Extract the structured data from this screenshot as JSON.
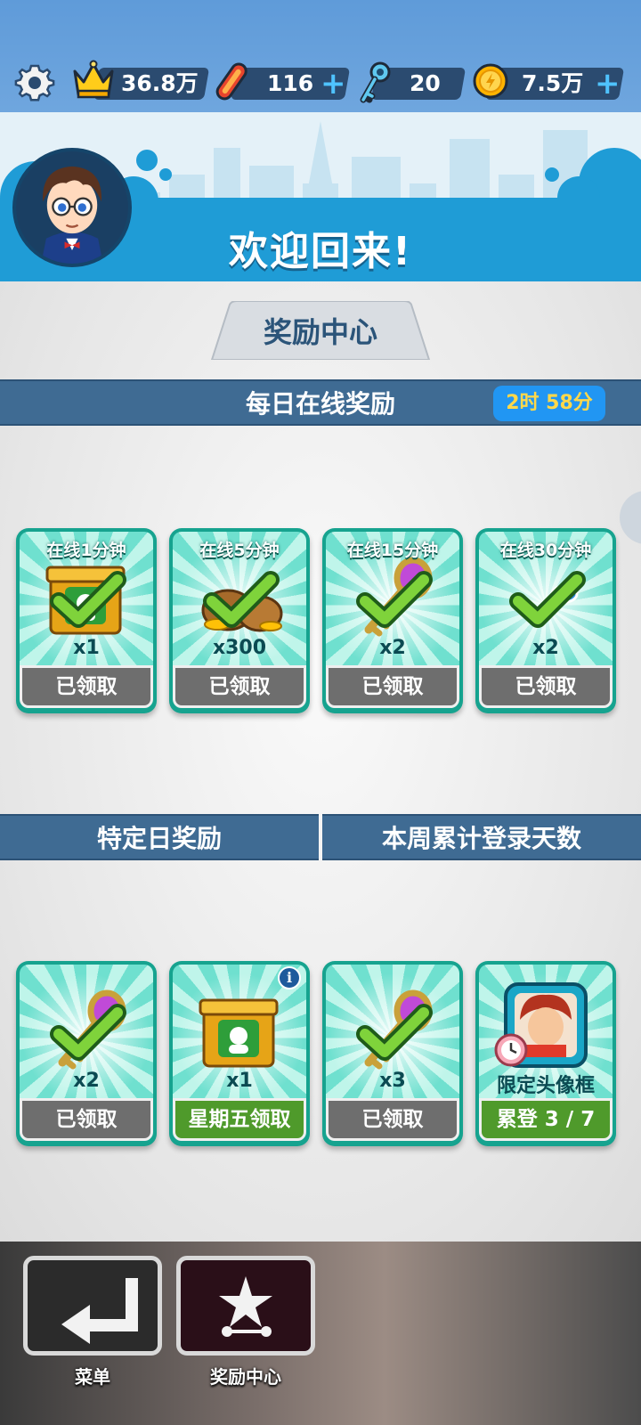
{
  "resources": {
    "crown": {
      "value": "36.8万",
      "icon": "crown-icon"
    },
    "hoverboard": {
      "value": "116",
      "icon": "hoverboard-icon"
    },
    "keys": {
      "value": "20",
      "icon": "key-icon"
    },
    "coins": {
      "value": "7.5万",
      "icon": "coin-icon"
    },
    "plus": "+"
  },
  "header": {
    "welcome": "欢迎回来!"
  },
  "tab": {
    "label": "奖励中心"
  },
  "daily": {
    "title": "每日在线奖励",
    "timer": "2时 58分",
    "cards": [
      {
        "title": "在线1分钟",
        "qty": "x1",
        "button": "已领取",
        "item": "mystery-box-icon"
      },
      {
        "title": "在线5分钟",
        "qty": "x300",
        "button": "已领取",
        "item": "coin-bags-icon"
      },
      {
        "title": "在线15分钟",
        "qty": "x2",
        "button": "已领取",
        "item": "key-icon"
      },
      {
        "title": "在线30分钟",
        "qty": "x2",
        "button": "已领取",
        "item": "hoverboard-icon"
      }
    ]
  },
  "special": {
    "left_title": "特定日奖励",
    "right_title": "本周累计登录天数",
    "cards": [
      {
        "qty": "x2",
        "button": "已领取",
        "item": "key-icon"
      },
      {
        "qty": "x1",
        "button": "星期五领取",
        "item": "mystery-box-icon"
      },
      {
        "qty": "x3",
        "button": "已领取",
        "item": "key-icon"
      },
      {
        "qty": "限定头像框",
        "button": "累登 3 / 7",
        "item": "avatar-frame-icon"
      }
    ]
  },
  "bottom": {
    "menu_label": "菜单",
    "rewards_label": "奖励中心"
  },
  "colors": {
    "top_bar": "#6fa6de",
    "section_bar": "#3f6b93",
    "card_teal": "#16a38f",
    "claimed_gray": "#6e6e6e",
    "claim_green": "#4f9a2b",
    "timer_blue": "#2196f3",
    "timer_text": "#ffd84a"
  }
}
